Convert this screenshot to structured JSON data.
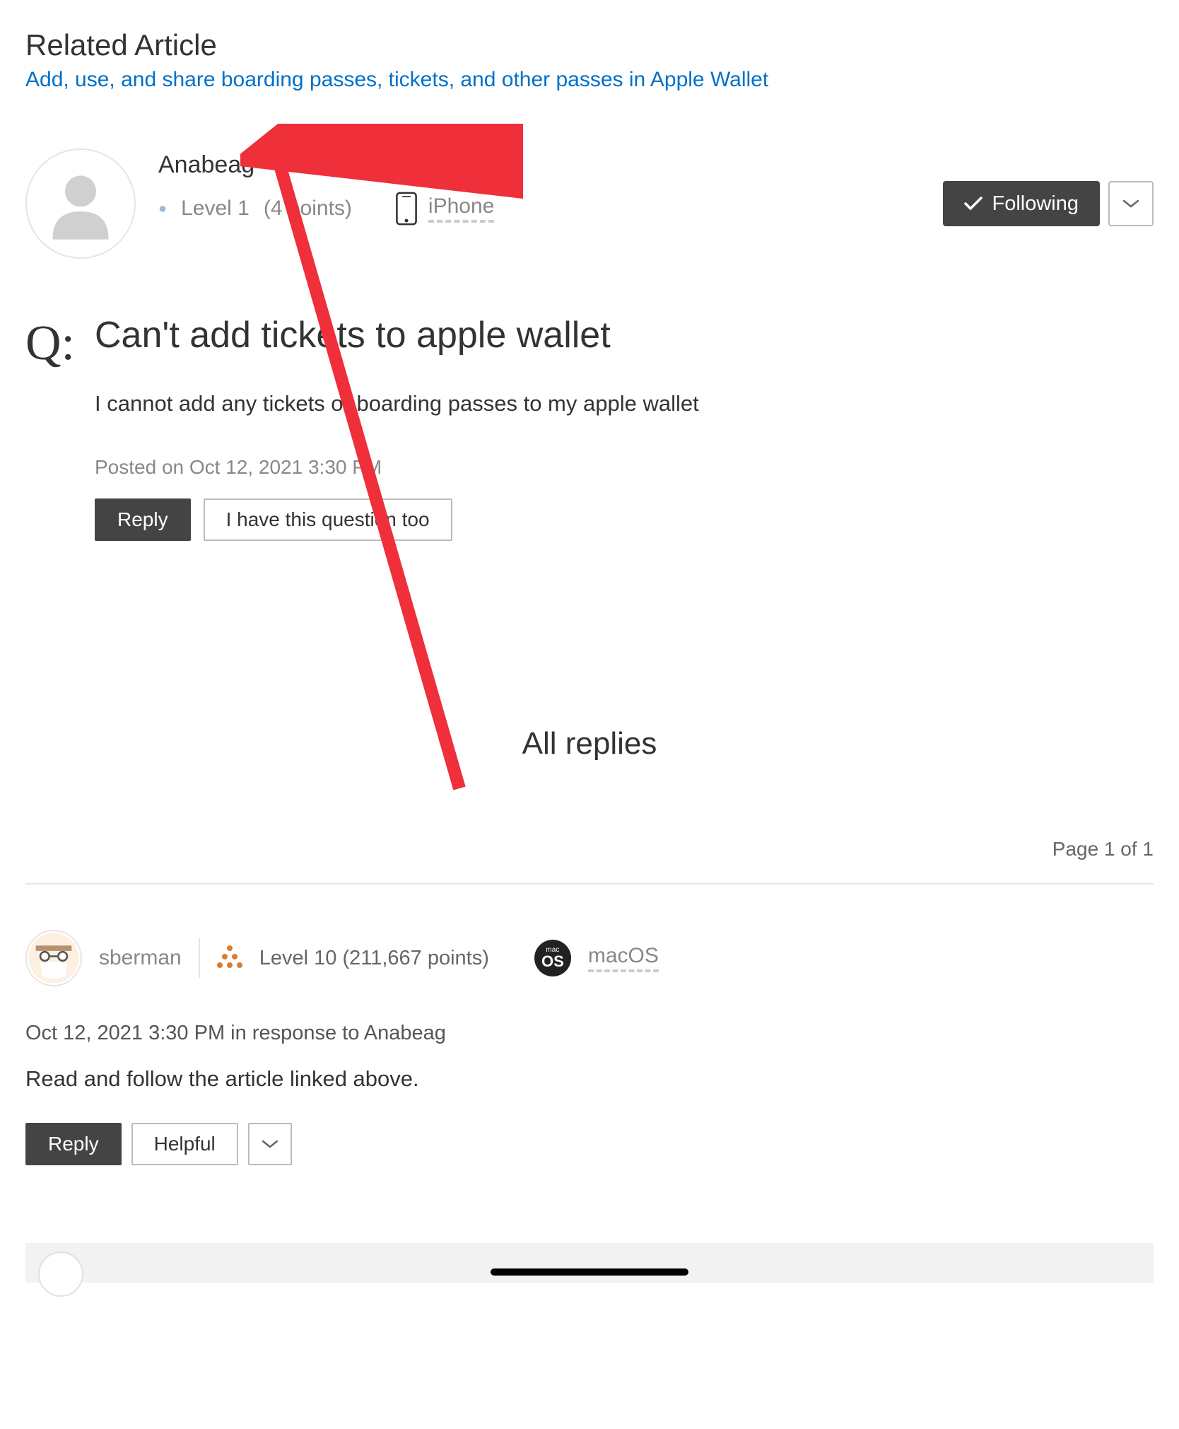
{
  "related": {
    "heading": "Related Article",
    "link_text": "Add, use, and share boarding passes, tickets, and other passes in Apple Wallet"
  },
  "poster": {
    "name": "Anabeag",
    "level": "Level 1",
    "points": "(4 points)",
    "device": "iPhone"
  },
  "follow": {
    "label": "Following"
  },
  "question": {
    "prefix": "Q:",
    "title": "Can't add tickets to apple wallet",
    "body": "I cannot add any tickets or boarding passes to my apple wallet",
    "posted": "Posted on Oct 12, 2021 3:30 PM",
    "reply_label": "Reply",
    "metoo_label": "I have this question too"
  },
  "replies": {
    "heading": "All replies",
    "page": "Page 1 of 1"
  },
  "reply1": {
    "name": "sberman",
    "level": "Level 10",
    "points": "(211,667 points)",
    "platform": "macOS",
    "meta": "Oct 12, 2021 3:30 PM in response to Anabeag",
    "body": "Read and follow the article linked above.",
    "reply_label": "Reply",
    "helpful_label": "Helpful"
  }
}
